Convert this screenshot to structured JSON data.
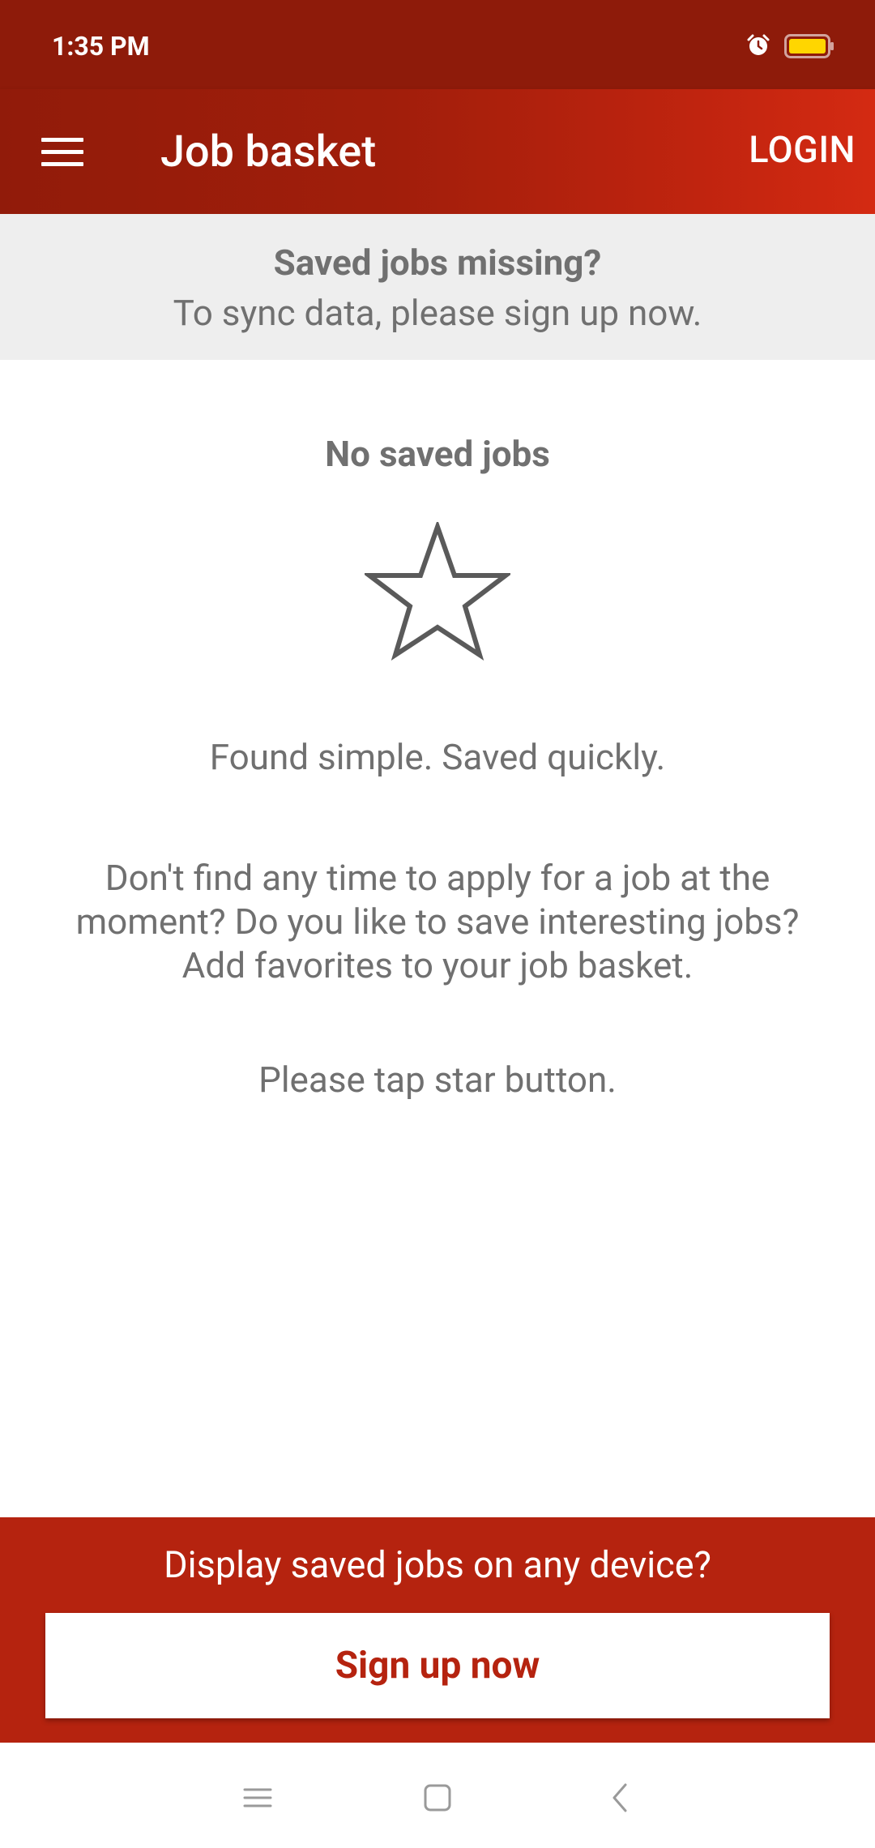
{
  "status_bar": {
    "time": "1:35 PM",
    "alarm_icon": "alarm-icon",
    "battery_icon": "battery-icon",
    "battery_color": "#ffd600"
  },
  "app_bar": {
    "menu_icon": "menu-icon",
    "title": "Job basket",
    "login_label": "LOGIN"
  },
  "sync_banner": {
    "title": "Saved jobs missing?",
    "subtitle": "To sync data, please sign up now."
  },
  "empty_state": {
    "title": "No saved jobs",
    "icon": "star-outline-icon",
    "tagline": "Found simple. Saved quickly.",
    "description": "Don't find any time to apply for a job at the moment? Do you like to save interesting jobs? Add favorites to your job basket.",
    "hint": "Please tap star button."
  },
  "signup_panel": {
    "prompt": "Display saved jobs on any device?",
    "button_label": "Sign up now"
  },
  "nav_bar": {
    "recents_icon": "recents-icon",
    "home_icon": "home-icon",
    "back_icon": "back-icon"
  },
  "colors": {
    "brand_dark": "#8e1b0a",
    "brand": "#b5230f",
    "brand_light": "#d42a12",
    "text_gray": "#707070",
    "banner_bg": "#eeeeee"
  }
}
